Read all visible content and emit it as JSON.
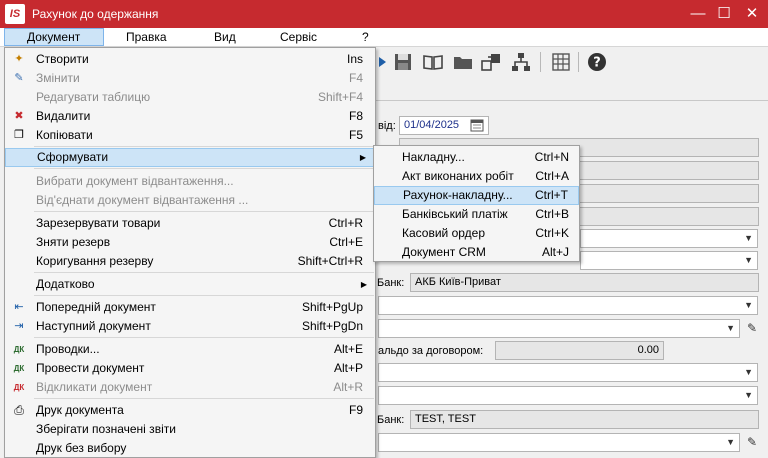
{
  "window": {
    "title": "Рахунок до одержання",
    "logo": "IS",
    "minimize": "—",
    "maximize": "☐",
    "close": "✕"
  },
  "menubar": {
    "items": [
      "Документ",
      "Правка",
      "Вид",
      "Сервіс",
      "?"
    ]
  },
  "form": {
    "date_from_label": "від:",
    "date_from": "01/04/2025",
    "bank1_label": "Банк:",
    "bank1_value": "АКБ Київ-Приват",
    "balance_label": "альдо за договором:",
    "balance_value": "0.00",
    "bank2_label": "Банк:",
    "bank2_value": "TEST, TEST"
  },
  "menu": {
    "create": {
      "label": "Створити",
      "shortcut": "Ins"
    },
    "edit": {
      "label": "Змінити",
      "shortcut": "F4"
    },
    "edit_table": {
      "label": "Редагувати таблицю",
      "shortcut": "Shift+F4"
    },
    "delete": {
      "label": "Видалити",
      "shortcut": "F8"
    },
    "copy": {
      "label": "Копіювати",
      "shortcut": "F5"
    },
    "form": {
      "label": "Сформувати"
    },
    "select_shipment": {
      "label": "Вибрати документ відвантаження..."
    },
    "unlink_shipment": {
      "label": "Від'єднати документ відвантаження ..."
    },
    "reserve": {
      "label": "Зарезервувати товари",
      "shortcut": "Ctrl+R"
    },
    "unreserve": {
      "label": "Зняти резерв",
      "shortcut": "Ctrl+E"
    },
    "adjust_reserve": {
      "label": "Коригування резерву",
      "shortcut": "Shift+Ctrl+R"
    },
    "additional": {
      "label": "Додатково"
    },
    "prev_doc": {
      "label": "Попередній документ",
      "shortcut": "Shift+PgUp"
    },
    "next_doc": {
      "label": "Наступний документ",
      "shortcut": "Shift+PgDn"
    },
    "postings": {
      "label": "Проводки...",
      "shortcut": "Alt+E"
    },
    "post_doc": {
      "label": "Провести документ",
      "shortcut": "Alt+P"
    },
    "recall_doc": {
      "label": "Відкликати документ",
      "shortcut": "Alt+R"
    },
    "print_doc": {
      "label": "Друк документа",
      "shortcut": "F9"
    },
    "save_reports": {
      "label": "Зберігати позначені звіти"
    },
    "print_no_select": {
      "label": "Друк без вибору"
    }
  },
  "submenu": {
    "items": [
      {
        "label": "Накладну...",
        "shortcut": "Ctrl+N"
      },
      {
        "label": "Акт виконаних робіт",
        "shortcut": "Ctrl+A"
      },
      {
        "label": "Рахунок-накладну...",
        "shortcut": "Ctrl+T"
      },
      {
        "label": "Банківський платіж",
        "shortcut": "Ctrl+B"
      },
      {
        "label": "Касовий ордер",
        "shortcut": "Ctrl+K"
      },
      {
        "label": "Документ CRM",
        "shortcut": "Alt+J"
      }
    ]
  },
  "colors": {
    "titlebar": "#c62a2f",
    "highlight": "#cde4f7"
  }
}
